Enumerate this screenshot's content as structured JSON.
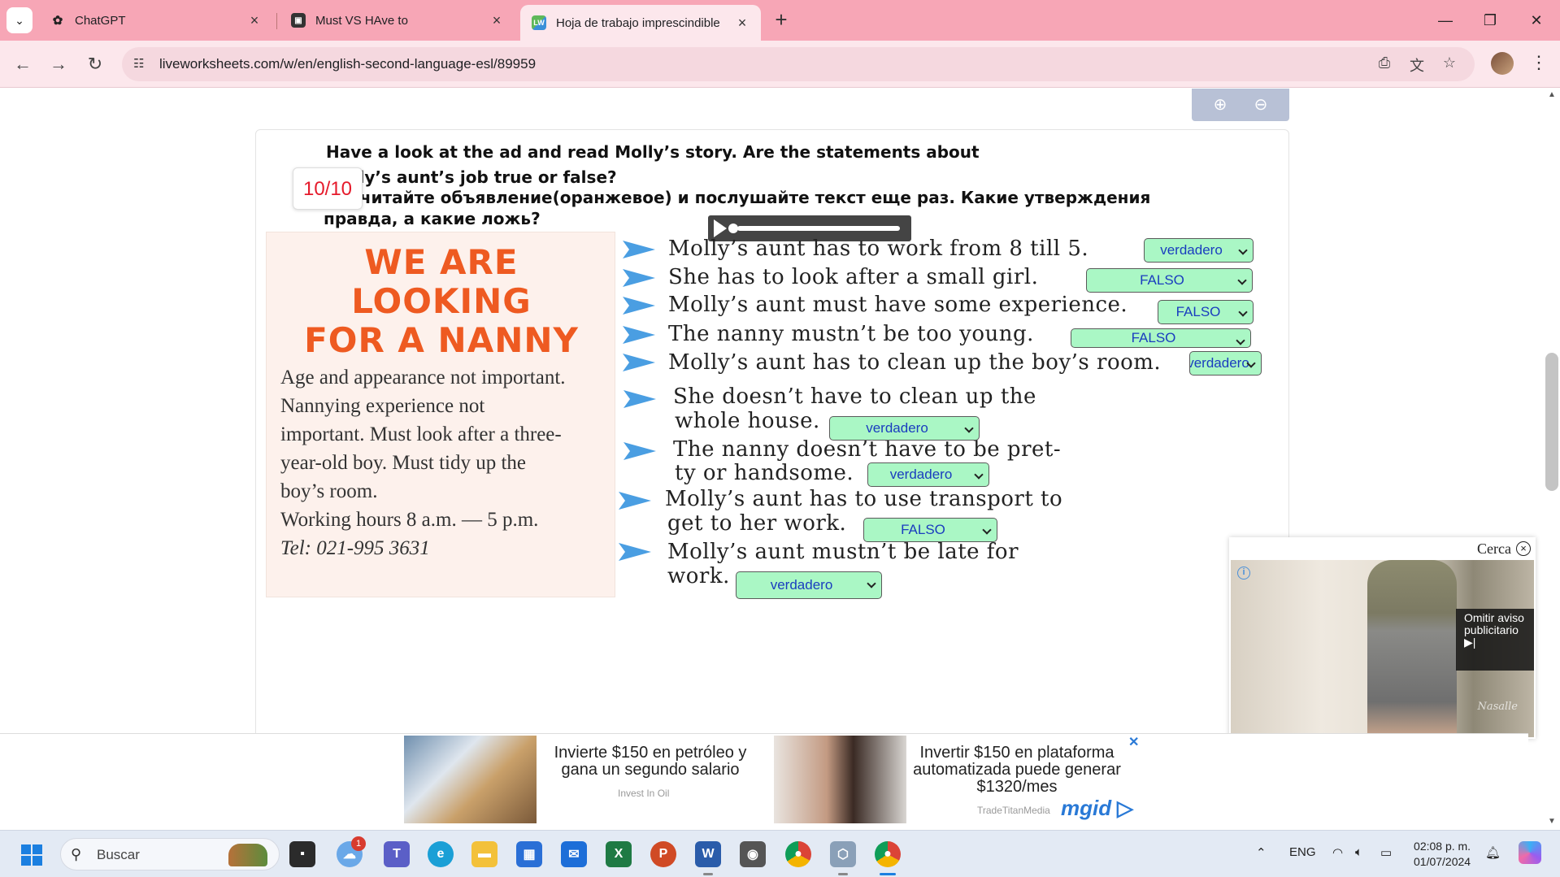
{
  "browser": {
    "tabs": [
      {
        "title": "ChatGPT",
        "icon": "chatgpt-icon",
        "active": false
      },
      {
        "title": "Must VS HAve to",
        "icon": "classroom-icon",
        "active": false
      },
      {
        "title": "Hoja de trabajo imprescindible",
        "icon": "liveworksheets-icon",
        "active": true
      }
    ],
    "url": "liveworksheets.com/w/en/english-second-language-esl/89959"
  },
  "worksheet": {
    "score": "10/10",
    "instructions": {
      "en_line1": "Have a look at the ad and read Molly’s story. Are the statements about",
      "en_line2": "Molly’s aunt’s job true or false?",
      "ru_line1": "Прочитайте объявление(оранжевое) и послушайте текст еще раз. Какие утверждения",
      "ru_line2": "правда, а какие ложь?"
    },
    "ad": {
      "head1": "WE   ARE",
      "head2": "LOOKING",
      "head3": "FOR A NANNY",
      "lines": [
        "Age and appearance not important.",
        "Nannying experience not",
        "important. Must look after a three-",
        "year-old boy. Must tidy up the",
        "boy’s room.",
        "Working  hours  8  a.m.  —  5  p.m.",
        "Tel:  021-995  3631"
      ]
    },
    "statements": [
      {
        "line1": "Molly’s aunt has to work from 8 till 5.",
        "line2": "",
        "answer": "verdadero"
      },
      {
        "line1": "She has to look after a small girl.",
        "line2": "",
        "answer": "FALSO"
      },
      {
        "line1": "Molly’s aunt must have some experience.",
        "line2": "",
        "answer": "FALSO"
      },
      {
        "line1": "The nanny mustn’t be too young.",
        "line2": "",
        "answer": "FALSO"
      },
      {
        "line1": "Molly’s aunt has to clean up the boy’s room.",
        "line2": "",
        "answer": "verdadero"
      },
      {
        "line1": "She doesn’t have to clean up the",
        "line2": "whole house.",
        "answer": "verdadero"
      },
      {
        "line1": "The nanny doesn’t have to be pret-",
        "line2": "ty or handsome.",
        "answer": "verdadero"
      },
      {
        "line1": "Molly’s aunt has to use transport to",
        "line2": "get to her work.",
        "answer": "FALSO"
      },
      {
        "line1": "Molly’s aunt mustn’t be late for",
        "line2": "work.",
        "answer": "verdadero"
      }
    ]
  },
  "video_ad": {
    "close_label": "Cerca",
    "skip_label": "Omitir aviso publicitario",
    "watermark": "Nasalle"
  },
  "banner_ad": {
    "ad1_text": "Invierte $150 en petróleo y gana un segundo salario",
    "ad1_source": "Invest In Oil",
    "ad2_text": "Invertir $150 en plataforma automatizada puede generar $1320/mes",
    "ad2_source": "TradeTitanMedia",
    "network": "mgid"
  },
  "taskbar": {
    "search_placeholder": "Buscar",
    "notification_count": "1",
    "language": "ENG",
    "time": "02:08 p. m.",
    "date": "01/07/2024"
  }
}
